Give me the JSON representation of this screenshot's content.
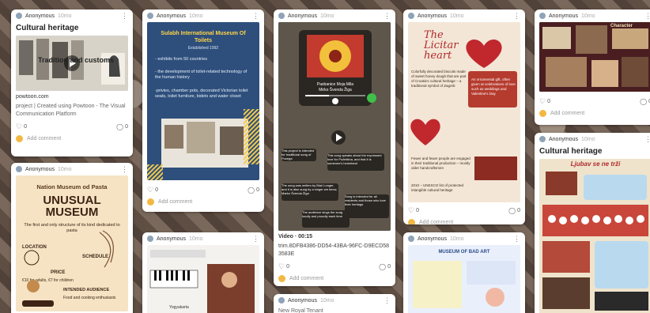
{
  "common": {
    "author": "Anonymous",
    "time": "10mo",
    "add_comment": "Add comment",
    "like_count": "0",
    "comment_count": "0"
  },
  "cards": {
    "c1": {
      "title": "Cultural heritage",
      "link_domain": "powtoon.com",
      "desc": "project | Created using Powtoon - The Visual Communication Platform",
      "media_text": "Tradition and customs"
    },
    "c2": {
      "poster_title": "Nation Museum od Pasta",
      "poster_big": "UNUSUAL MUSEUM",
      "poster_line1": "The first and only structure of its kind dedicated to pasta",
      "poster_loc": "LOCATION",
      "poster_sched": "SCHEDULE",
      "poster_price": "PRICE",
      "poster_price_val": "€10 for adults, €7 for children",
      "poster_aud": "INTENDED AUDIENCE",
      "poster_aud_val": "Food and cooking enthusiasts"
    },
    "c3": {
      "poster_title": "Sulabh International Museum Of Toilets",
      "poster_est": "Established 1992",
      "poster_p1": "- exhibits from 50 countries",
      "poster_p2": "- the development of toilet-related technology of the human history",
      "poster_p3": "-privies, chamber pots, decorated Victorian toilet seats, toilet furniture, bidets and water closet"
    },
    "c4": {
      "media_kind": "music player",
      "track": "Pasbanice Moja Mila",
      "artist": "Mirko Švenda Žiga",
      "cap1": "This project is intended for traditional song of Pozega",
      "cap2": "This song speaks about the expressed love for Požeština, and that it is someone's homeland",
      "cap3": "The song was written by Blaž Longer, and it is also sung by a singer we know, Marko Švenda Žiga",
      "cap4": "Song is intended for all residents and those who love their heritage",
      "cap5": "The audience sings the song loudly and proudly each time",
      "video_label": "Video · 00:15",
      "file_id": "trim.8DFB4386-DD54-43BA-96FC-D9ECD583583E"
    },
    "c5": {
      "title_script": "The Licitar heart",
      "p1": "Colorfully decorated biscuits made of sweet honey dough that are part of Croatia's cultural heritage – a traditional symbol of Zagreb",
      "p2": "An ornamental gift, often given at celebrations of love such as weddings and Valentine's Day",
      "p3": "Fewer and fewer people are engaged in their traditional production – mostly older handcraftsmen",
      "p4": "2010 – UNESCO list of protected intangible cultural heritage"
    },
    "c6": {
      "poster_title": "Character"
    },
    "c7": {
      "title": "Cultural heritage",
      "poster_title": "Ljubav se ne trži"
    },
    "c8": {
      "poster_title": "MUSEUM OF BAD ART"
    },
    "c9": {
      "poster_title": "Yogyakarta"
    },
    "c10": {
      "poster_title": "New Royal Tenant"
    }
  }
}
